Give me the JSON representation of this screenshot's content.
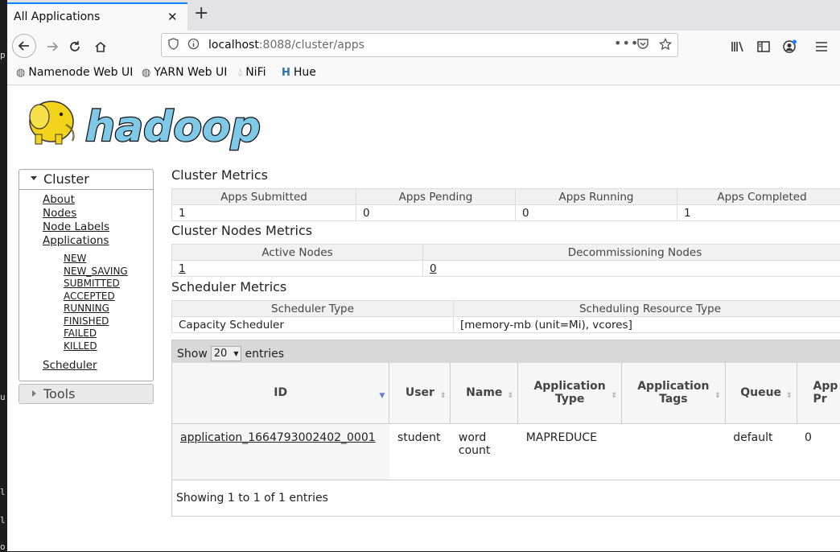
{
  "browser": {
    "tab_title": "All Applications",
    "tab_close": "✕",
    "new_tab": "+",
    "url_host": "localhost",
    "url_rest": ":8088/cluster/apps",
    "bookmarks": [
      "Namenode Web UI",
      "YARN Web UI",
      "NiFi",
      "Hue"
    ]
  },
  "terminal_glyphs": [
    "p",
    "u",
    "l",
    "l",
    "o"
  ],
  "logo_text": "hadoop",
  "sidebar": {
    "cluster_title": "Cluster",
    "links": [
      "About",
      "Nodes",
      "Node Labels",
      "Applications"
    ],
    "app_states": [
      "NEW",
      "NEW_SAVING",
      "SUBMITTED",
      "ACCEPTED",
      "RUNNING",
      "FINISHED",
      "FAILED",
      "KILLED"
    ],
    "scheduler": "Scheduler",
    "tools_title": "Tools"
  },
  "cluster_metrics": {
    "title": "Cluster Metrics",
    "headers": [
      "Apps Submitted",
      "Apps Pending",
      "Apps Running",
      "Apps Completed"
    ],
    "values": [
      "1",
      "0",
      "0",
      "1"
    ]
  },
  "node_metrics": {
    "title": "Cluster Nodes Metrics",
    "headers": [
      "Active Nodes",
      "Decommissioning Nodes"
    ],
    "values": [
      "1",
      "0"
    ]
  },
  "scheduler_metrics": {
    "title": "Scheduler Metrics",
    "headers": [
      "Scheduler Type",
      "Scheduling Resource Type"
    ],
    "values": [
      "Capacity Scheduler",
      "[memory-mb (unit=Mi), vcores]"
    ]
  },
  "apps": {
    "show_label": "Show",
    "page_size": "20",
    "entries_label": "entries",
    "headers": [
      "ID",
      "User",
      "Name",
      "Application Type",
      "Application Tags",
      "Queue",
      "App Pr"
    ],
    "rows": [
      {
        "id": "application_1664793002402_0001",
        "user": "student",
        "name": "word count",
        "type": "MAPREDUCE",
        "tags": "",
        "queue": "default",
        "priority": "0"
      }
    ],
    "footer": "Showing 1 to 1 of 1 entries"
  }
}
